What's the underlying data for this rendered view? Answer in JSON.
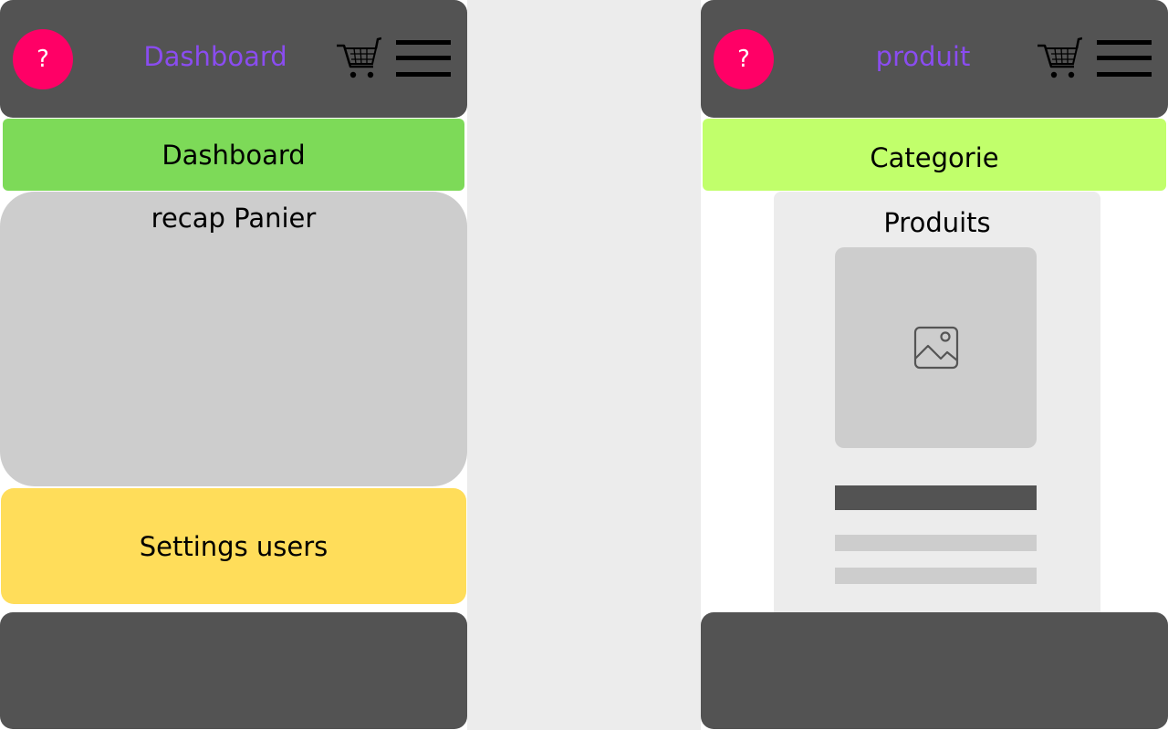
{
  "colors": {
    "header_bg": "#535353",
    "help_button": "#ff0066",
    "title_purple": "#8a4cf0",
    "dashboard_nav": "#7dda58",
    "categorie_nav": "#c1ff6b",
    "recap_panel": "#cdcdcd",
    "settings_yellow": "#ffdd5a",
    "footer_bg": "#535353"
  },
  "left_screen": {
    "header": {
      "help_label": "?",
      "title": "Dashboard",
      "cart_icon": "shopping-cart-icon",
      "menu_icon": "hamburger-menu-icon"
    },
    "nav_label": "Dashboard",
    "recap_title": "recap Panier",
    "settings_label": "Settings users"
  },
  "right_screen": {
    "header": {
      "help_label": "?",
      "title": "produit",
      "cart_icon": "shopping-cart-icon",
      "menu_icon": "hamburger-menu-icon"
    },
    "nav_label": "Categorie",
    "product_title": "Produits",
    "product_image_icon": "image-placeholder-icon"
  }
}
